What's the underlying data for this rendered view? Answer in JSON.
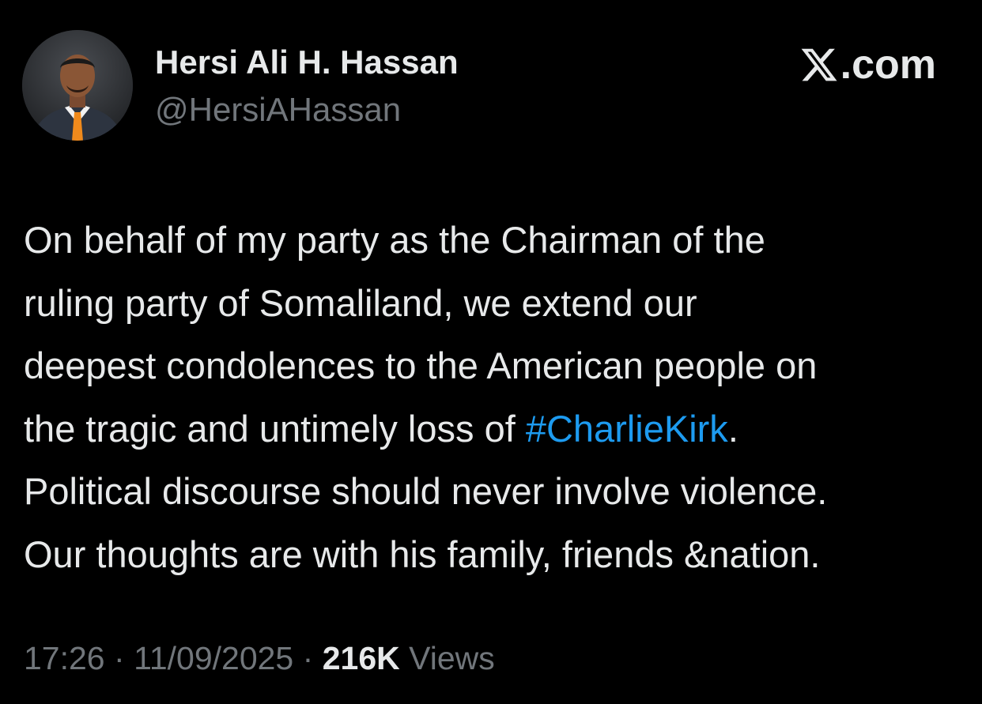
{
  "author": {
    "name": "Hersi Ali H. Hassan",
    "handle": "@HersiAHassan",
    "avatar_icon": "profile-photo-icon"
  },
  "brand": {
    "logo_icon": "x-logo-icon",
    "suffix": ".com"
  },
  "tweet": {
    "lines": [
      {
        "text": "On behalf of my party as the Chairman of the"
      },
      {
        "text": "ruling party of Somaliland, we extend our"
      },
      {
        "text": "deepest condolences to the American people on"
      },
      {
        "before": "the tragic and untimely loss of ",
        "hashtag": "#CharlieKirk",
        "after": "."
      },
      {
        "text": "Political discourse should never involve violence."
      },
      {
        "text": "Our thoughts are with his family, friends &nation."
      }
    ]
  },
  "meta": {
    "time": "17:26",
    "separator": "·",
    "date": "11/09/2025",
    "views_count": "216K",
    "views_label": "Views"
  },
  "colors": {
    "background": "#000000",
    "text_primary": "#e7e9ea",
    "text_secondary": "#71767b",
    "hashtag": "#1d9bf0"
  }
}
